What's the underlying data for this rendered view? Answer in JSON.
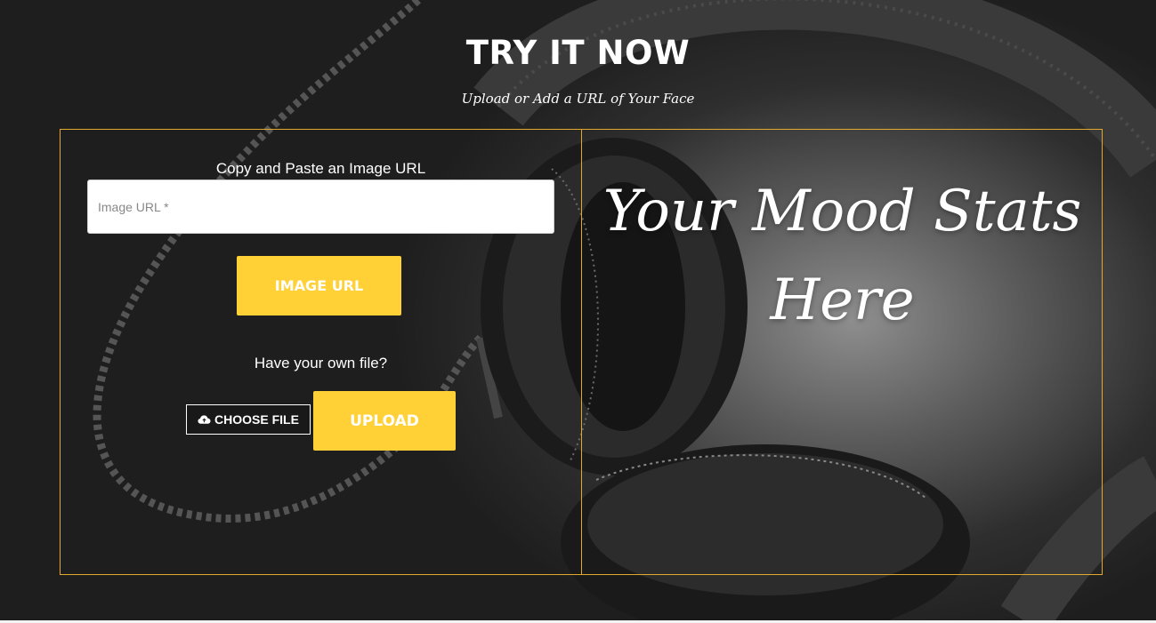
{
  "header": {
    "title": "TRY IT NOW",
    "subtitle": "Upload or Add a URL of Your Face"
  },
  "left_panel": {
    "url_label": "Copy and Paste an Image URL",
    "url_input": {
      "value": "",
      "placeholder": "Image URL *"
    },
    "image_url_button": "IMAGE URL",
    "own_file_label": "Have your own file?",
    "choose_file_icon": "cloud-upload-icon",
    "choose_file_label": "CHOOSE FILE",
    "upload_button": "UPLOAD"
  },
  "right_panel": {
    "mood_line1": "Your Mood Stats",
    "mood_line2": "Here"
  },
  "colors": {
    "accent_yellow": "#ffd136",
    "panel_border": "#e3a92a",
    "text": "#ffffff"
  }
}
